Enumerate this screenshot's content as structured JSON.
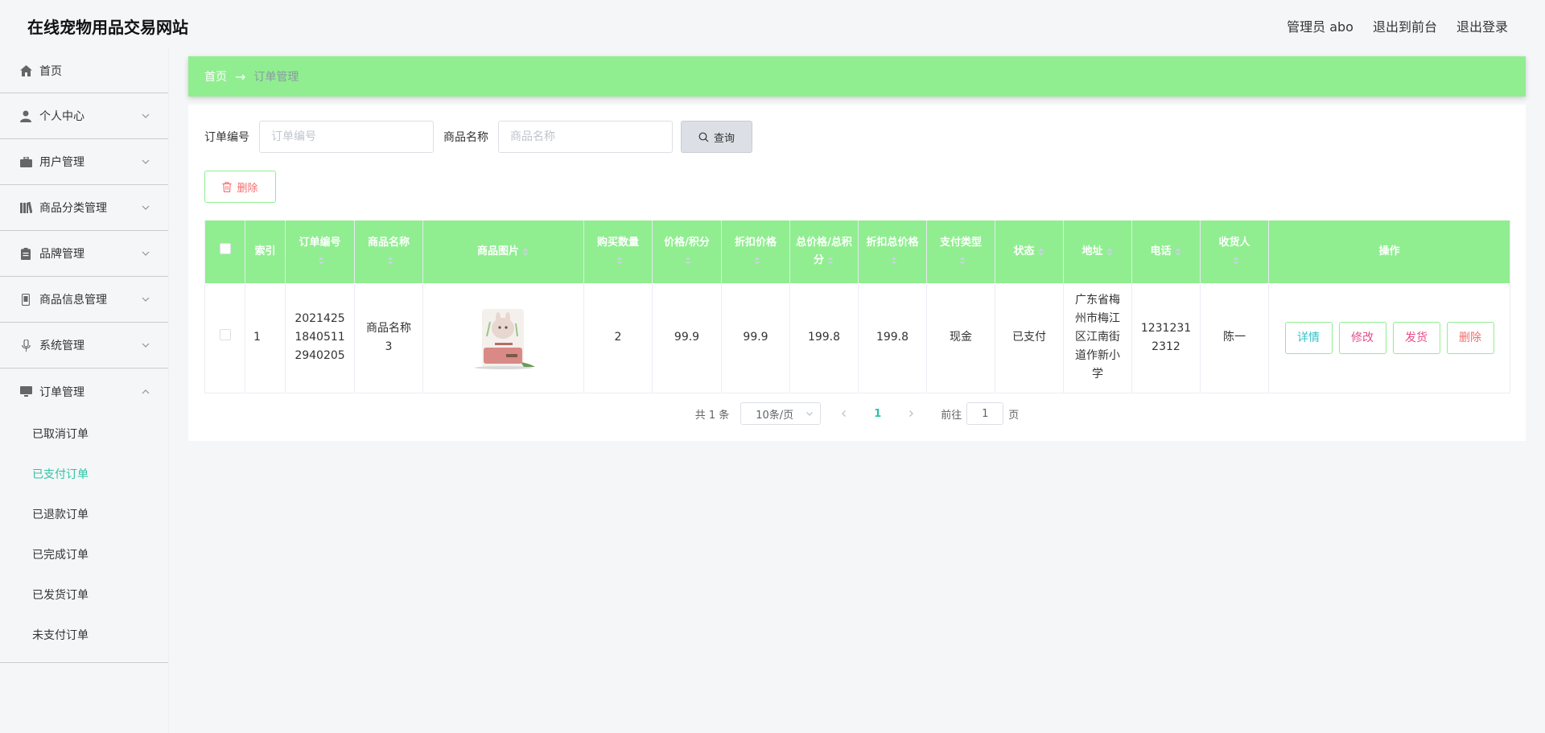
{
  "app": {
    "title": "在线宠物用品交易网站"
  },
  "header": {
    "admin_label": "管理员 abo",
    "front_label": "退出到前台",
    "logout_label": "退出登录"
  },
  "sidebar": {
    "items": [
      {
        "label": "首页",
        "icon": "home-icon"
      },
      {
        "label": "个人中心",
        "icon": "user-icon"
      },
      {
        "label": "用户管理",
        "icon": "briefcase-icon"
      },
      {
        "label": "商品分类管理",
        "icon": "library-icon"
      },
      {
        "label": "品牌管理",
        "icon": "clipboard-icon"
      },
      {
        "label": "商品信息管理",
        "icon": "phone-icon"
      },
      {
        "label": "系统管理",
        "icon": "microphone-icon"
      },
      {
        "label": "订单管理",
        "icon": "monitor-icon"
      }
    ],
    "sub_items": [
      {
        "label": "已取消订单"
      },
      {
        "label": "已支付订单",
        "active": true
      },
      {
        "label": "已退款订单"
      },
      {
        "label": "已完成订单"
      },
      {
        "label": "已发货订单"
      },
      {
        "label": "未支付订单"
      }
    ]
  },
  "breadcrumb": {
    "home": "首页",
    "separator": "→",
    "current": "订单管理"
  },
  "search": {
    "order_no_label": "订单编号",
    "order_no_placeholder": "订单编号",
    "goods_name_label": "商品名称",
    "goods_name_placeholder": "商品名称",
    "query_label": "查询"
  },
  "toolbar": {
    "delete_label": "删除"
  },
  "table": {
    "headers": [
      "索引",
      "订单编号",
      "商品名称",
      "商品图片",
      "购买数量",
      "价格/积分",
      "折扣价格",
      "总价格/总积分",
      "折扣总价格",
      "支付类型",
      "状态",
      "地址",
      "电话",
      "收货人",
      "操作"
    ],
    "rows": [
      {
        "index": "1",
        "order_no": "20214251840511 2940205",
        "goods_name": "商品名称3",
        "quantity": "2",
        "price": "99.9",
        "discount_price": "99.9",
        "total_price": "199.8",
        "discount_total": "199.8",
        "pay_type": "现金",
        "status": "已支付",
        "address": "广东省梅州市梅江区江南街道作新小学",
        "phone": "12312312312",
        "receiver": "陈一",
        "ops": {
          "detail": "详情",
          "edit": "修改",
          "ship": "发货",
          "delete": "删除"
        }
      }
    ]
  },
  "pagination": {
    "total": "共 1 条",
    "page_size": "10条/页",
    "current_page": "1",
    "goto_label": "前往",
    "goto_value": "1",
    "page_suffix": "页"
  },
  "colors": {
    "accent_green": "#90ee90",
    "active_teal": "#2cc4a4",
    "danger": "#f56c6c"
  }
}
